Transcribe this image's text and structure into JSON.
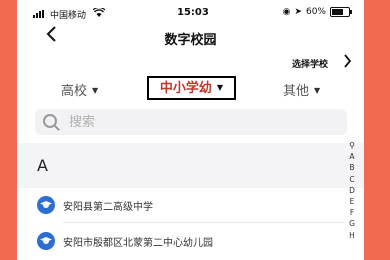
{
  "status_bar": {
    "carrier": "中国移动",
    "time": "15:03",
    "battery": "60%"
  },
  "nav": {
    "title": "数字校园",
    "select_school": "选择学校"
  },
  "tabs": [
    {
      "label": "高校",
      "selected": false
    },
    {
      "label": "中小学幼",
      "selected": true
    },
    {
      "label": "其他",
      "selected": false
    }
  ],
  "search": {
    "placeholder": "搜索"
  },
  "sections": [
    {
      "letter": "A",
      "items": [
        "安阳县第二高级中学",
        "安阳市殷都区北蒙第二中心幼儿园"
      ]
    }
  ],
  "index_letters": [
    "A",
    "B",
    "C",
    "D",
    "E",
    "F",
    "G",
    "H"
  ],
  "colors": {
    "accent_red": "#c0392b",
    "school_icon_blue": "#2c6fd1",
    "frame": "#f26a4f"
  }
}
